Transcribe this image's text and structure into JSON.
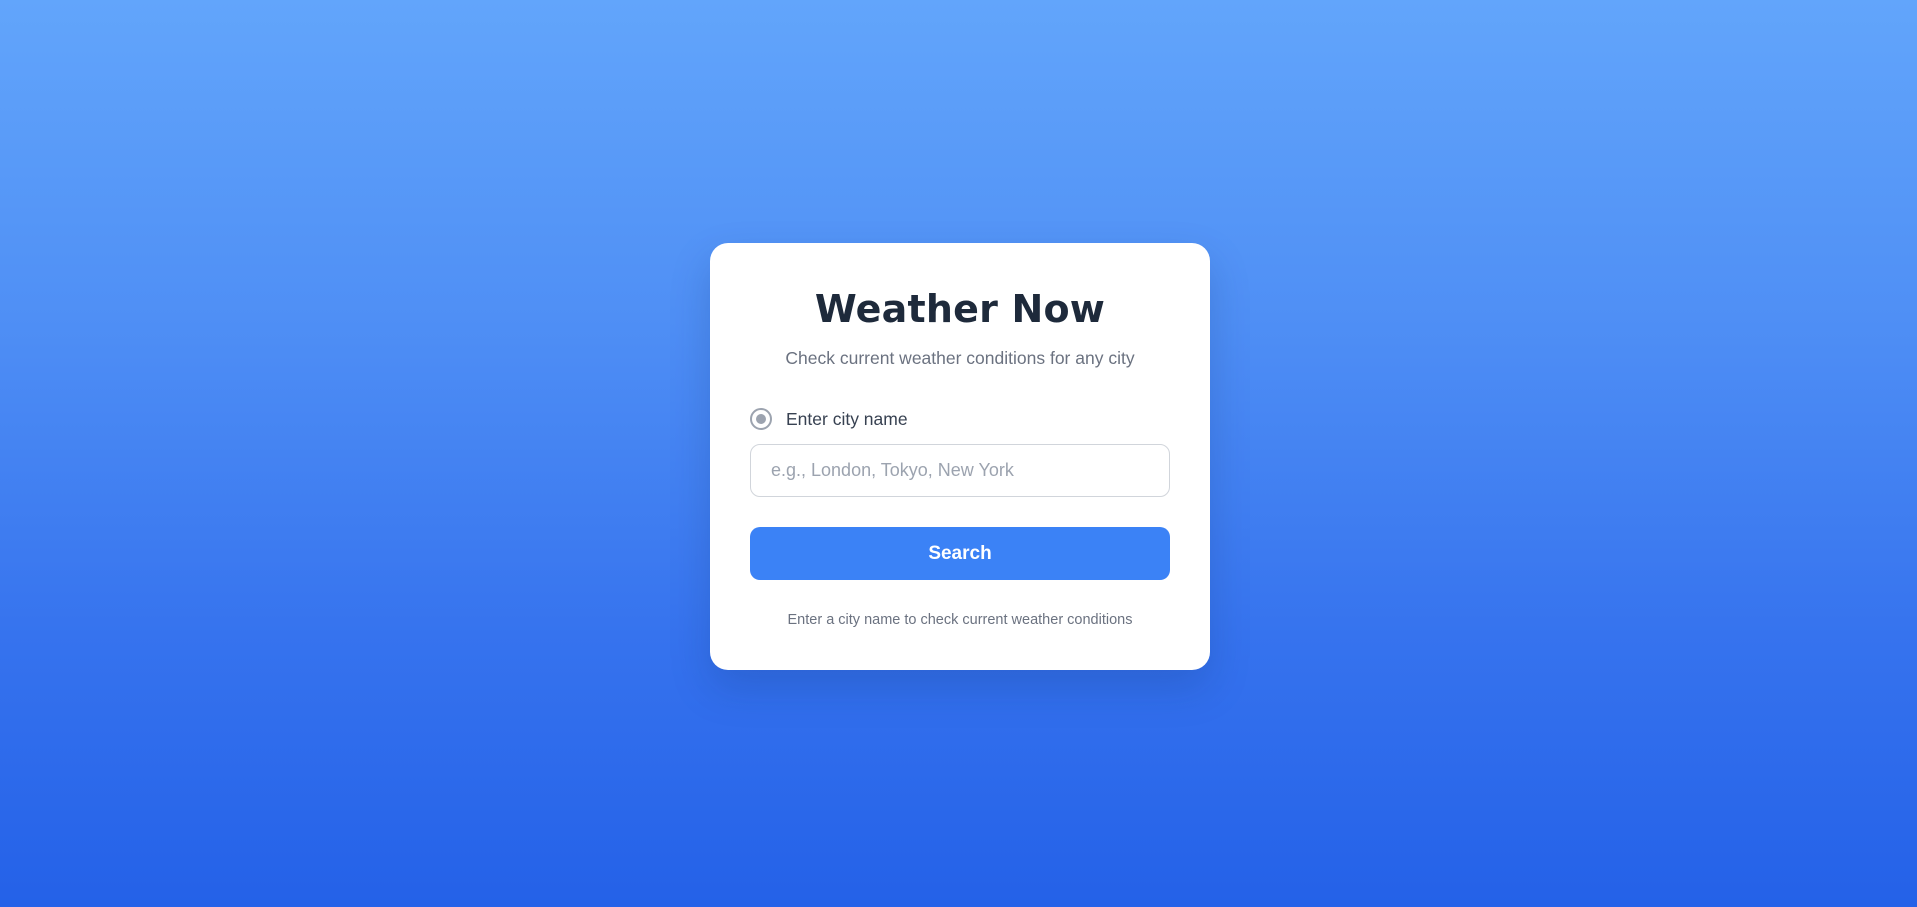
{
  "card": {
    "title": "Weather Now",
    "subtitle": "Check current weather conditions for any city",
    "city_label": "Enter city name",
    "city_input": {
      "value": "",
      "placeholder": "e.g., London, Tokyo, New York"
    },
    "search_label": "Search",
    "hint": "Enter a city name to check current weather conditions"
  },
  "icons": {
    "location": "radio-target-icon"
  },
  "colors": {
    "background_top": "#62a5fb",
    "background_bottom": "#2461e8",
    "accent": "#3b82f6",
    "title": "#1e2a3b",
    "muted_text": "#6b7280"
  }
}
